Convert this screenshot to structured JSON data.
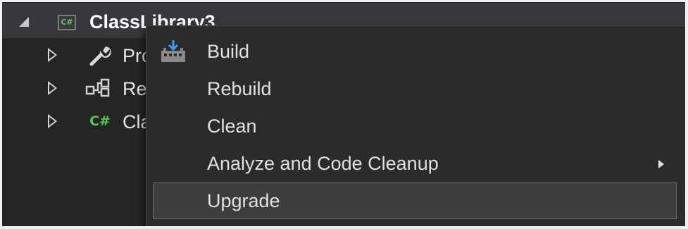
{
  "solution_explorer": {
    "project": {
      "icon": "csharp-project-icon",
      "icon_text": "C#",
      "name": "ClassLibrary3",
      "expanded": true
    },
    "children": [
      {
        "icon": "wrench-icon",
        "label": "Pro",
        "expanded": false
      },
      {
        "icon": "references-icon",
        "label": "Re",
        "expanded": false
      },
      {
        "icon": "csharp-file-icon",
        "icon_text": "C#",
        "label": "Cla",
        "expanded": false
      }
    ]
  },
  "context_menu": {
    "items": [
      {
        "label": "Build",
        "icon": "build-icon",
        "has_submenu": false,
        "highlighted": false
      },
      {
        "label": "Rebuild",
        "has_submenu": false,
        "highlighted": false
      },
      {
        "label": "Clean",
        "has_submenu": false,
        "highlighted": false
      },
      {
        "label": "Analyze and Code Cleanup",
        "has_submenu": true,
        "highlighted": false
      },
      {
        "label": "Upgrade",
        "has_submenu": false,
        "highlighted": true
      }
    ]
  },
  "colors": {
    "background": "#252526",
    "menu_background": "#2b2b2b",
    "menu_text": "#e0e0e0",
    "csharp_green": "#4ec94e",
    "build_icon_blue": "#3b9cff",
    "highlight_border": "#6a6a6a"
  }
}
